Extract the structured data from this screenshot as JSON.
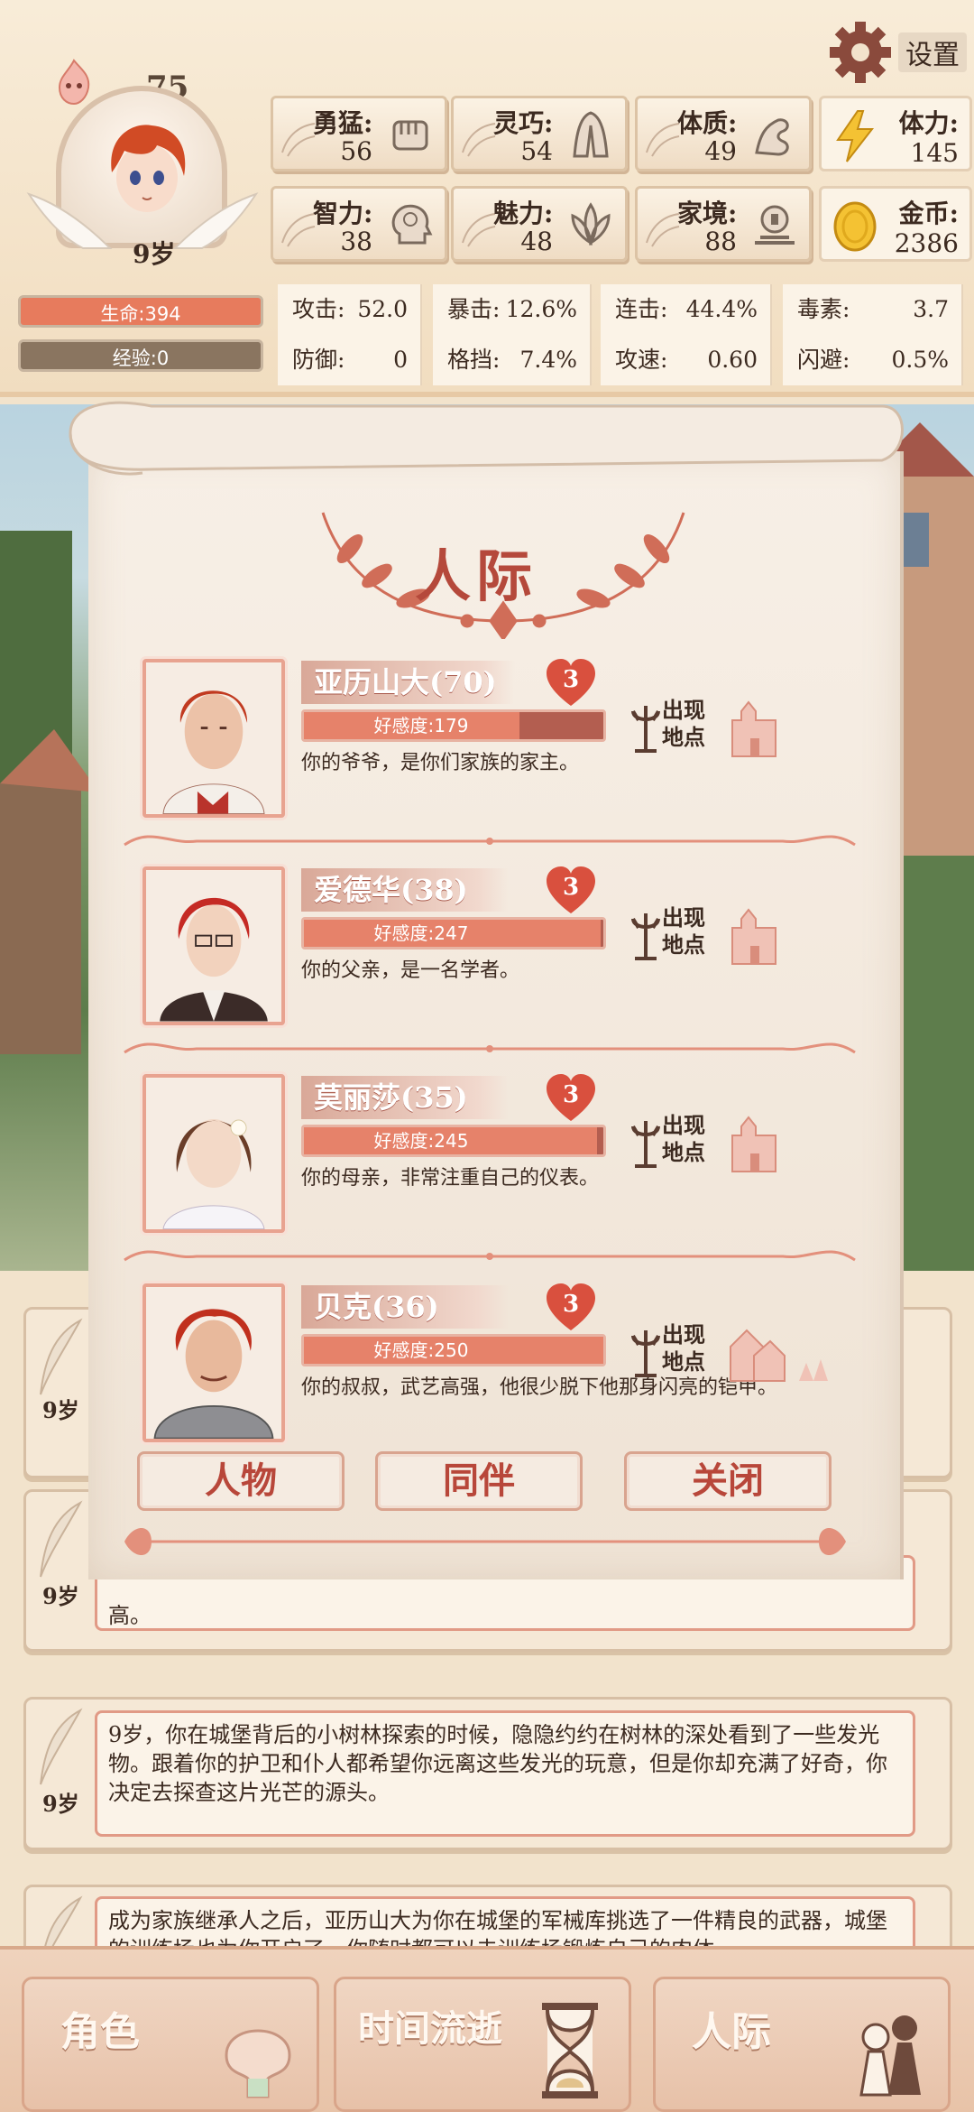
{
  "header": {
    "level": "75",
    "age": "9岁",
    "hp_label": "生命:394",
    "exp_label": "经验:0",
    "settings_label": "设置"
  },
  "stats": [
    {
      "label": "勇猛:",
      "value": "56",
      "icon": "fist-icon"
    },
    {
      "label": "灵巧:",
      "value": "54",
      "icon": "cloak-icon"
    },
    {
      "label": "体质:",
      "value": "49",
      "icon": "muscle-arm-icon"
    },
    {
      "label": "智力:",
      "value": "38",
      "icon": "brain-head-icon"
    },
    {
      "label": "魅力:",
      "value": "48",
      "icon": "lotus-icon"
    },
    {
      "label": "家境:",
      "value": "88",
      "icon": "coin-stack-icon"
    }
  ],
  "resources": [
    {
      "label": "体力:",
      "value": "145",
      "icon": "lightning-icon"
    },
    {
      "label": "金币:",
      "value": "2386",
      "icon": "gold-coin-icon"
    }
  ],
  "attributes": [
    {
      "label": "攻击:",
      "value": "52.0"
    },
    {
      "label": "暴击:",
      "value": "12.6%"
    },
    {
      "label": "连击:",
      "value": "44.4%"
    },
    {
      "label": "毒素:",
      "value": "3.7"
    },
    {
      "label": "防御:",
      "value": "0"
    },
    {
      "label": "格挡:",
      "value": "7.4%"
    },
    {
      "label": "攻速:",
      "value": "0.60"
    },
    {
      "label": "闪避:",
      "value": "0.5%"
    }
  ],
  "dialog": {
    "title": "人际",
    "location_label_1": "出现",
    "location_label_2": "地点",
    "characters": [
      {
        "name": "亚历山大(70)",
        "hearts": "3",
        "affinity_label": "好感度:179",
        "affinity_fraction": 0.72,
        "description": "你的爷爷，是你们家族的家主。",
        "location_icon": "castle-icon"
      },
      {
        "name": "爱德华(38)",
        "hearts": "3",
        "affinity_label": "好感度:247",
        "affinity_fraction": 0.99,
        "description": "你的父亲，是一名学者。",
        "location_icon": "castle-icon"
      },
      {
        "name": "莫丽莎(35)",
        "hearts": "3",
        "affinity_label": "好感度:245",
        "affinity_fraction": 0.98,
        "description": "你的母亲，非常注重自己的仪表。",
        "location_icon": "castle-icon"
      },
      {
        "name": "贝克(36)",
        "hearts": "3",
        "affinity_label": "好感度:250",
        "affinity_fraction": 1.0,
        "description": "你的叔叔，武艺高强，他很少脱下他那身闪亮的铠甲。",
        "location_icon": "village-icon"
      }
    ],
    "buttons": {
      "people": "人物",
      "companion": "同伴",
      "close": "关闭"
    }
  },
  "log": [
    {
      "age": "9岁",
      "text": ""
    },
    {
      "age": "9岁",
      "text": "高。"
    },
    {
      "age": "9岁",
      "text": "9岁，你在城堡背后的小树林探索的时候，隐隐约约在树林的深处看到了一些发光物。跟着你的护卫和仆人都希望你远离这些发光的玩意，但是你却充满了好奇，你决定去探查这片光芒的源头。"
    },
    {
      "age": "",
      "text": "成为家族继承人之后，亚历山大为你在城堡的军械库挑选了一件精良的武器，城堡的训练场也为你开启了，你随时都可以去训练场锻炼自己的肉体"
    }
  ],
  "nav": {
    "role": "角色",
    "time": "时间流逝",
    "social": "人际"
  },
  "colors": {
    "accent": "#b5493b",
    "hp": "#e77b5d",
    "exp": "#8a7560",
    "heart": "#d9503e"
  }
}
